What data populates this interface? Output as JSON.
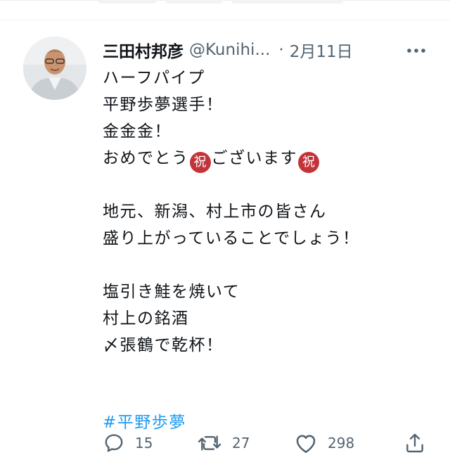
{
  "tweet": {
    "author_name": "三田村邦彦",
    "handle": "@Kunihi...",
    "separator": "·",
    "date": "2月11日",
    "lines": {
      "l1": "ハーフパイプ",
      "l2": "平野歩夢選手！",
      "l3": "金金金！",
      "l4a": "おめでとう",
      "l4emoji1": "祝",
      "l4b": "ございます",
      "l4emoji2": "祝",
      "l5": "地元、新潟、村上市の皆さん",
      "l6": "盛り上がっていることでしょう！",
      "l7": "塩引き鮭を焼いて",
      "l8": "村上の銘酒",
      "l9": "〆張鶴で乾杯！"
    },
    "hashtag": "#平野歩夢"
  },
  "actions": {
    "reply_count": "15",
    "retweet_count": "27",
    "like_count": "298"
  },
  "colors": {
    "text": "#0f1419",
    "secondary": "#536471",
    "link": "#1d9bf0",
    "emoji_bg": "#c2343a"
  },
  "icons": [
    "more-icon",
    "reply-icon",
    "retweet-icon",
    "like-icon",
    "share-icon"
  ]
}
